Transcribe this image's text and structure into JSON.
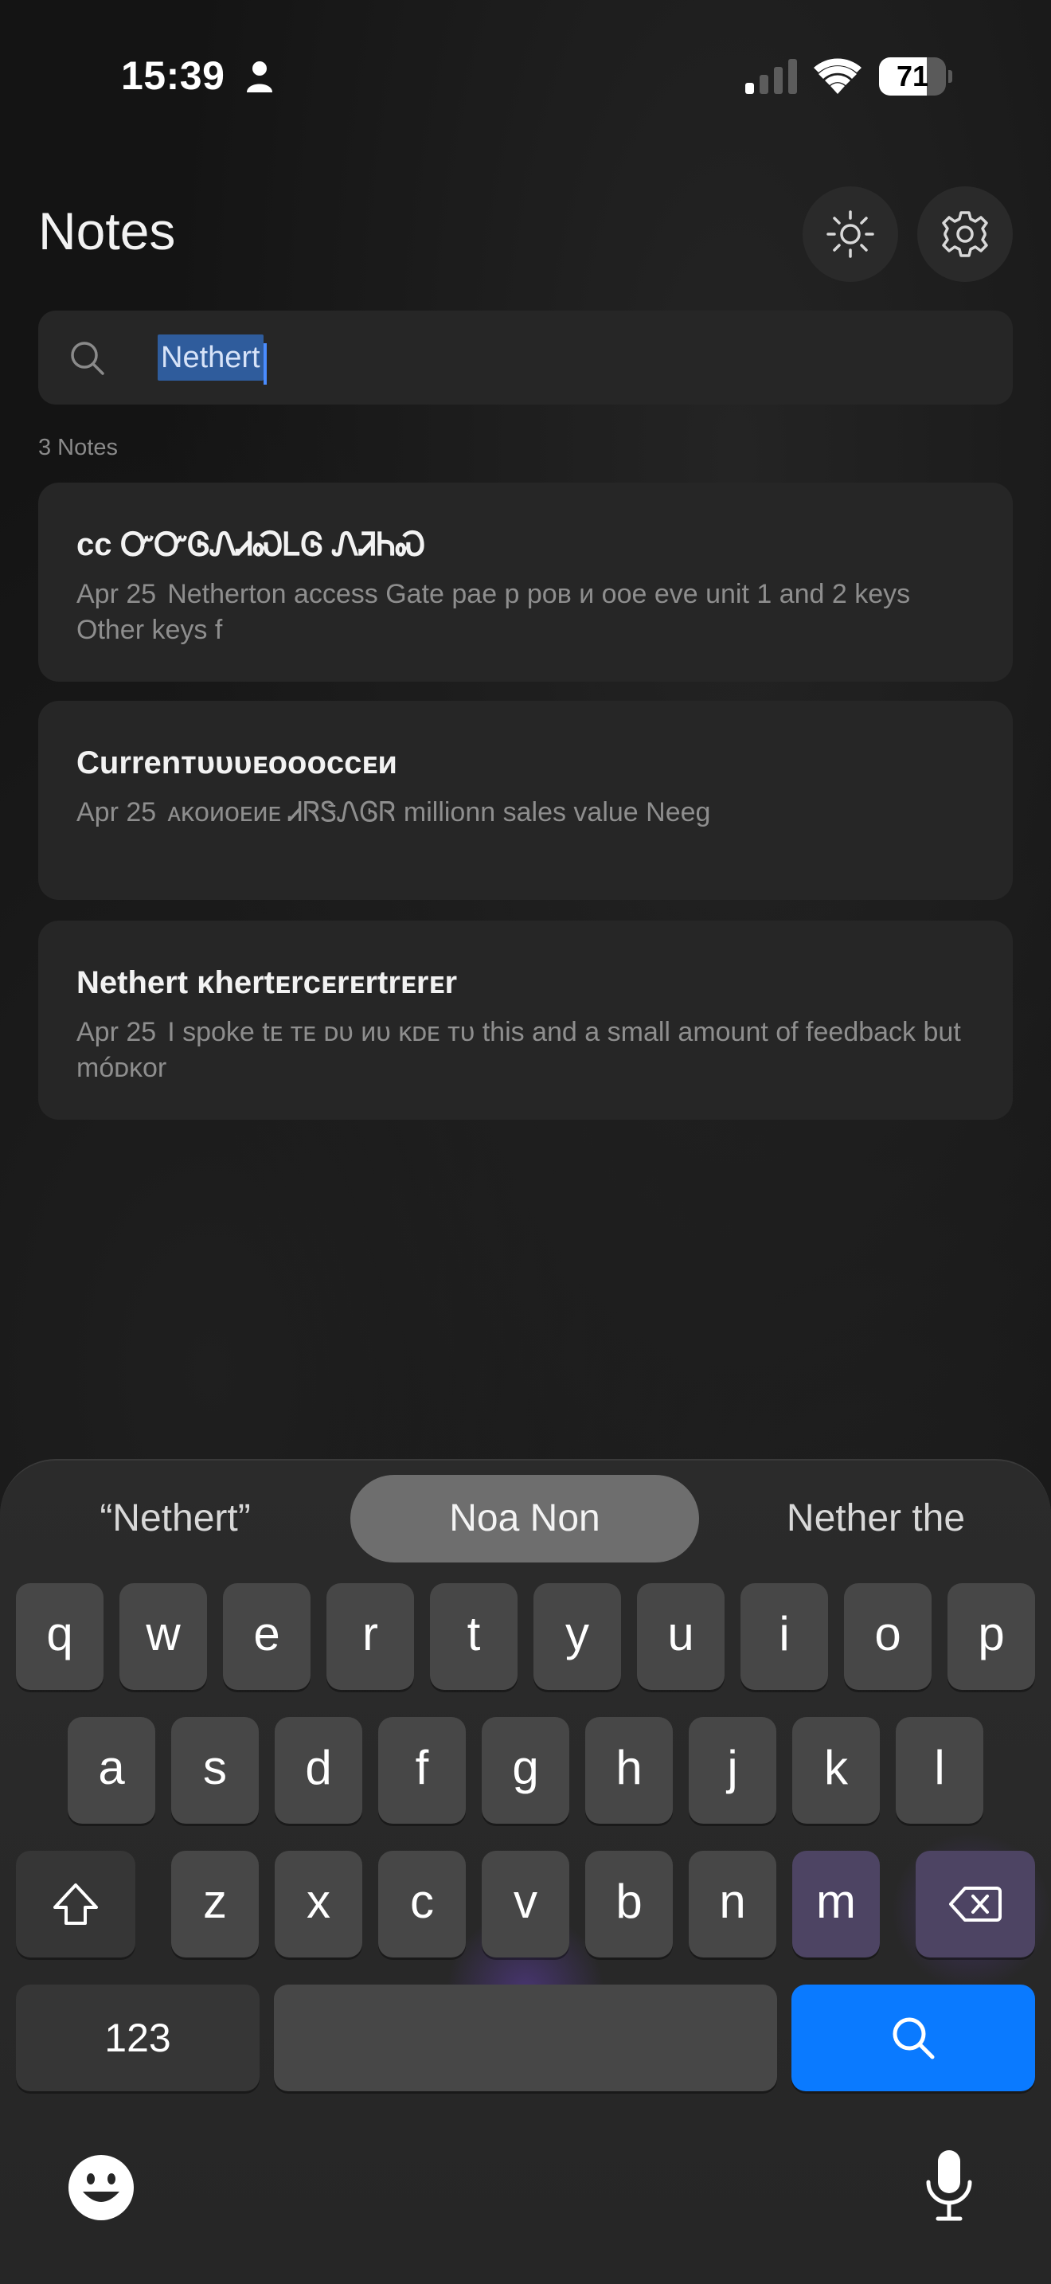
{
  "status_bar": {
    "time": "15:39",
    "battery_level": "71",
    "icons": [
      "person-icon",
      "signal-icon",
      "wifi-icon",
      "battery-icon"
    ]
  },
  "header": {
    "title": "Notes",
    "theme_icon": "sun-icon",
    "settings_icon": "gear-icon"
  },
  "search": {
    "value": "Nethert",
    "icon": "search-icon"
  },
  "note_count": "3 Notes",
  "notes": [
    {
      "title": "ᴄᴄ ᏅᏅᎶᏁᏗᏍᏞᎶ ᏁᏘᏂᏍ",
      "date": "Apr 25",
      "preview": "Netherton access  Gate paе р ров и оое еve unit 1 and 2 keys  Other  keys f"
    },
    {
      "title": "Currenᴛᴜᴜᴜᴇᴏᴏᴏᴄᴄᴇᴎ",
      "date": "Apr 25",
      "preview": "ᴀᴋᴏᴎᴏᴇᴎᴇ ᏗᏒᏕᏁᎶᏒ millionn sales value Neeg"
    },
    {
      "title": "Nethert ᴋhertᴇrᴄᴇrᴇrtrᴇrᴇr",
      "date": "Apr 25",
      "preview": "I spoke tᴇ ᴛᴇ ᴅᴜ ᴎᴜ ᴋᴅᴇ ᴛᴜ this and a small amount of feedback but móᴅᴋᴏr"
    }
  ],
  "keyboard": {
    "suggestions": [
      "“Nethert”",
      "Noa  Non",
      "Nether the"
    ],
    "row1": [
      "q",
      "w",
      "e",
      "r",
      "t",
      "y",
      "u",
      "i",
      "o",
      "p"
    ],
    "row2": [
      "a",
      "s",
      "d",
      "f",
      "g",
      "h",
      "j",
      "k",
      "l"
    ],
    "row3": [
      "z",
      "x",
      "c",
      "v",
      "b",
      "n",
      "m"
    ],
    "numbers_label": "123",
    "shift_icon": "shift-icon",
    "delete_icon": "delete-icon",
    "search_key_icon": "search-icon",
    "emoji_icon": "emoji-icon",
    "mic_icon": "mic-icon",
    "accent_color": "#0a7aff"
  }
}
